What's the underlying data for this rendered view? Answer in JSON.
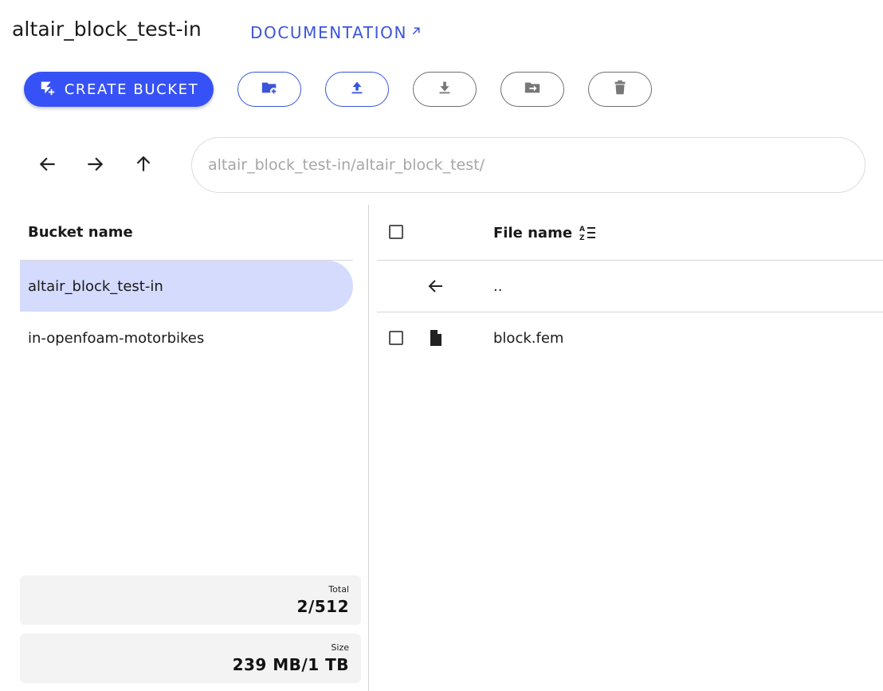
{
  "header": {
    "title": "altair_block_test-in",
    "doc_link_label": "DOCUMENTATION"
  },
  "toolbar": {
    "create_bucket_label": "CREATE BUCKET",
    "accent_color": "#3652f6",
    "buttons": [
      {
        "icon": "create-folder-icon",
        "state": "enabled"
      },
      {
        "icon": "upload-icon",
        "state": "enabled"
      },
      {
        "icon": "download-icon",
        "state": "disabled"
      },
      {
        "icon": "move-icon",
        "state": "disabled"
      },
      {
        "icon": "delete-icon",
        "state": "disabled"
      }
    ]
  },
  "navigation": {
    "path_value": "altair_block_test-in/altair_block_test/",
    "icons": [
      "back-arrow-icon",
      "forward-arrow-icon",
      "up-arrow-icon"
    ]
  },
  "buckets": {
    "header": "Bucket name",
    "selected_color": "#d5dbfd",
    "items": [
      {
        "name": "altair_block_test-in",
        "selected": true
      },
      {
        "name": "in-openfoam-motorbikes",
        "selected": false
      }
    ]
  },
  "stats": {
    "total_label": "Total",
    "total_value": "2/512",
    "size_label": "Size",
    "size_value": "239 MB/1 TB"
  },
  "files": {
    "header": "File name",
    "parent_label": "..",
    "items": [
      {
        "name": "block.fem",
        "icon": "file-icon"
      }
    ]
  }
}
